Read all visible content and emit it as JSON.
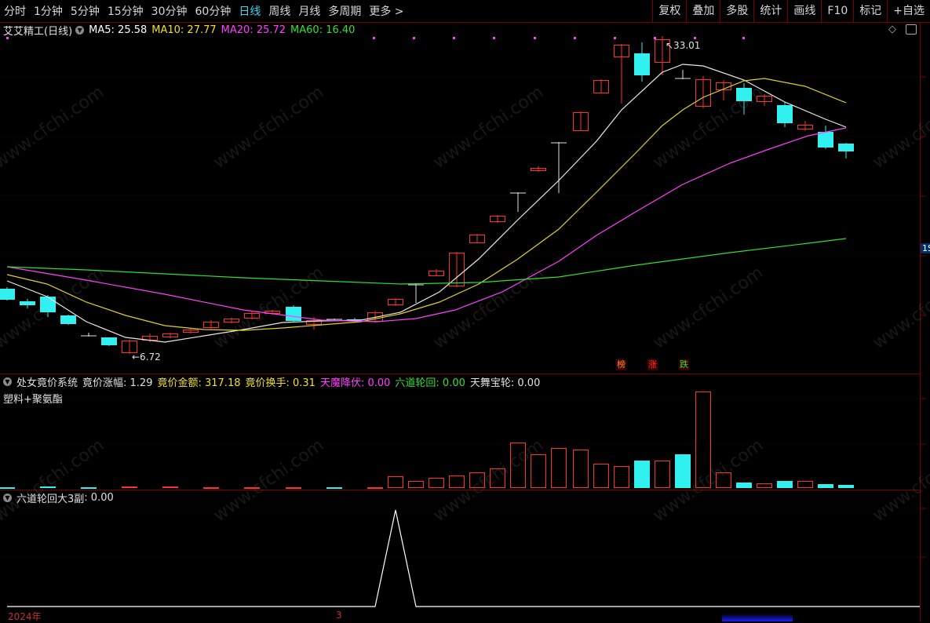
{
  "toolbar": {
    "periods": [
      "分时",
      "1分钟",
      "5分钟",
      "15分钟",
      "30分钟",
      "60分钟",
      "日线",
      "周线",
      "月线",
      "多周期",
      "更多 >"
    ],
    "active": "日线",
    "right": [
      "复权",
      "叠加",
      "多股",
      "统计",
      "画线",
      "F10",
      "标记",
      "+自选"
    ]
  },
  "main": {
    "title": "艾艾精工(日线)",
    "ma": [
      {
        "label": "MA5: 25.58",
        "color": "#ffffff"
      },
      {
        "label": "MA10: 27.77",
        "color": "#f0e020"
      },
      {
        "label": "MA20: 25.72",
        "color": "#ff40ff"
      },
      {
        "label": "MA60: 16.40",
        "color": "#30e030"
      }
    ],
    "high_label": "33.01",
    "low_label": "6.72",
    "axis_tag": "1S",
    "marks": [
      {
        "text": "榜",
        "color": "#ff8c1a"
      },
      {
        "text": "涨",
        "color": "#ff3030"
      },
      {
        "text": "跌",
        "color": "#30e030"
      }
    ]
  },
  "ind1": {
    "name": "处女竟价系统",
    "values": [
      {
        "label": "竟价涨幅: 1.29",
        "color": "#e0e0e0"
      },
      {
        "label": "竟价金额: 317.18",
        "color": "#f0e020"
      },
      {
        "label": "竟价换手: 0.31",
        "color": "#f0e020"
      },
      {
        "label": "天魔降伏: 0.00",
        "color": "#ff40ff"
      },
      {
        "label": "六道轮回: 0.00",
        "color": "#30e030"
      },
      {
        "label": "天舞宝轮: 0.00",
        "color": "#e0e0e0"
      }
    ],
    "sector": "塑料+聚氨酯"
  },
  "ind2": {
    "name": "六道轮回大3副",
    "value": ": 0.00"
  },
  "xaxis": {
    "year": "2024年",
    "month": "3"
  },
  "watermark": "www.cfchi.com",
  "colors": {
    "up": "#ff3030",
    "down": "#30f0f0",
    "frame": "#7a0000"
  }
}
